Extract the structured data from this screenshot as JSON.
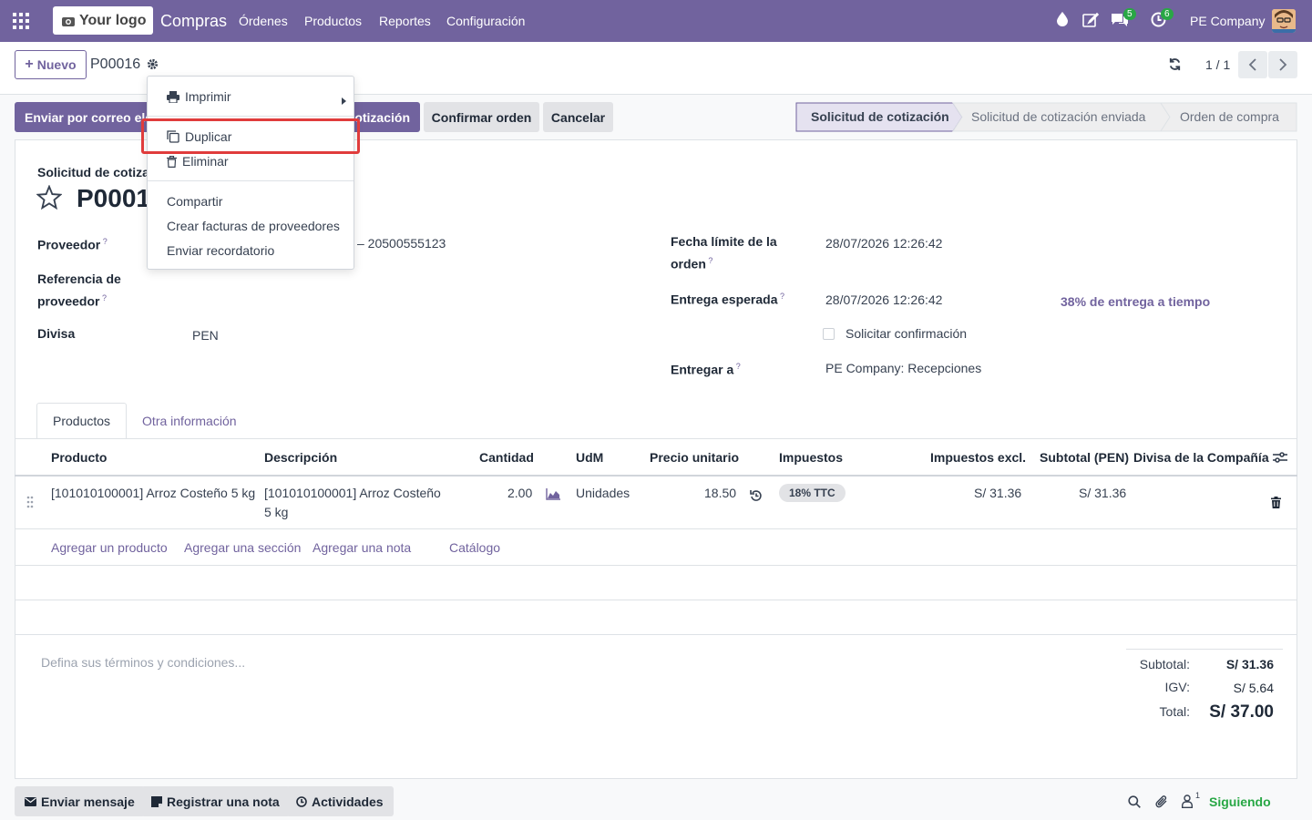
{
  "navbar": {
    "logo_text": "Your logo",
    "app_name": "Compras",
    "menus": [
      "Órdenes",
      "Productos",
      "Reportes",
      "Configuración"
    ],
    "chat_count": "5",
    "activity_count": "6",
    "company": "PE Company"
  },
  "control_panel": {
    "new_label": "Nuevo",
    "record_name": "P00016",
    "pager": "1 / 1"
  },
  "actions": {
    "send_email": "Enviar por correo ele",
    "print_quote": "otización",
    "confirm": "Confirmar orden",
    "cancel": "Cancelar"
  },
  "statusbar": [
    "Solicitud de cotización",
    "Solicitud de cotización enviada",
    "Orden de compra"
  ],
  "gear_menu": {
    "print": "Imprimir",
    "duplicate": "Duplicar",
    "delete": "Eliminar",
    "share": "Compartir",
    "create_bills": "Crear facturas de proveedores",
    "reminder": "Enviar recordatorio"
  },
  "form": {
    "subtitle": "Solicitud de cotizac",
    "name": "P0001",
    "vendor_label": "Proveedor",
    "vendor_value": "– 20500555123",
    "vendor_ref_label_1": "Referencia de",
    "vendor_ref_label_2": "proveedor",
    "currency_label": "Divisa",
    "currency_value": "PEN",
    "deadline_label_1": "Fecha límite de la",
    "deadline_label_2": "orden",
    "deadline_value": "28/07/2026 12:26:42",
    "expected_label": "Entrega esperada",
    "expected_value": "28/07/2026 12:26:42",
    "on_time": "38% de entrega a tiempo",
    "ask_confirm": "Solicitar confirmación",
    "deliver_label": "Entregar a",
    "deliver_value": "PE Company: Recepciones"
  },
  "tabs": [
    "Productos",
    "Otra información"
  ],
  "table": {
    "headers": [
      "Producto",
      "Descripción",
      "Cantidad",
      "UdM",
      "Precio unitario",
      "Impuestos",
      "Impuestos excl.",
      "Subtotal (PEN)",
      "Divisa de la Compañía"
    ],
    "row": {
      "product": "[101010100001] Arroz Costeño 5 kg",
      "desc_1": "[101010100001] Arroz Costeño",
      "desc_2": "5 kg",
      "qty": "2.00",
      "uom": "Unidades",
      "price": "18.50",
      "tax": "18% TTC",
      "untaxed": "S/ 31.36",
      "subtotal": "S/ 31.36"
    },
    "add_product": "Agregar un producto",
    "add_section": "Agregar una sección",
    "add_note": "Agregar una nota",
    "catalog": "Catálogo"
  },
  "terms_placeholder": "Defina sus términos y condiciones...",
  "totals": {
    "subtotal_label": "Subtotal:",
    "subtotal_value": "S/ 31.36",
    "igv_label": "IGV:",
    "igv_value": "S/ 5.64",
    "total_label": "Total:",
    "total_value": "S/ 37.00"
  },
  "chatter": {
    "send_message": "Enviar mensaje",
    "log_note": "Registrar una nota",
    "activities": "Actividades",
    "followers": "1",
    "following": "Siguiendo"
  }
}
